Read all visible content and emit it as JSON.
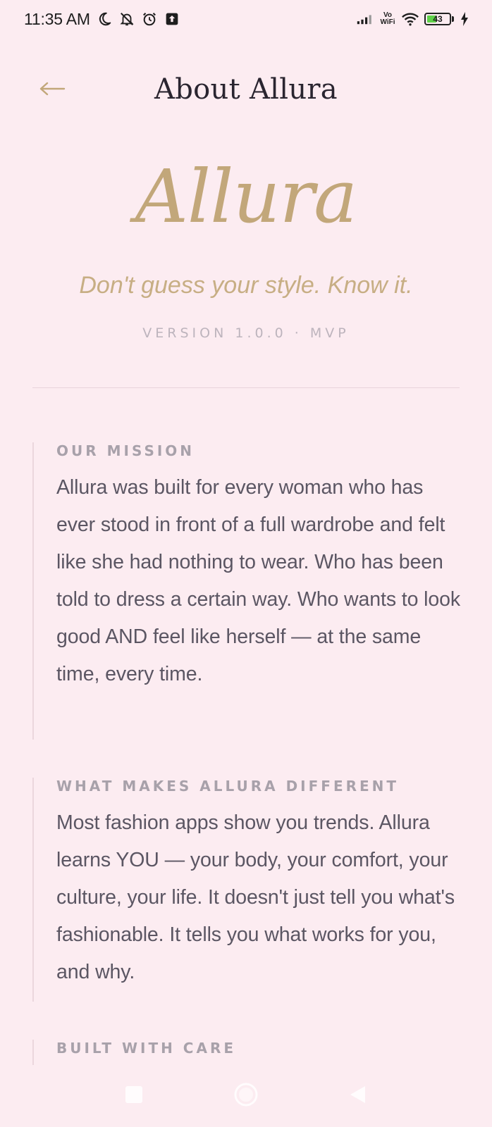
{
  "status_bar": {
    "time": "11:35 AM",
    "icons": [
      "moon-icon",
      "bell-off-icon",
      "alarm-icon",
      "upload-icon",
      "signal-icon",
      "vowifi-icon",
      "wifi-icon",
      "battery-icon",
      "charging-icon"
    ],
    "vowifi_line1": "Vo",
    "vowifi_line2": "WiFi",
    "battery_level": "43",
    "battery_fraction": 0.43
  },
  "header": {
    "back_icon": "arrow-left-icon",
    "title": "About Allura"
  },
  "hero": {
    "brand": "Allura",
    "tagline": "Don't guess your style. Know it.",
    "version": "VERSION 1.0.0 · MVP"
  },
  "sections": [
    {
      "heading": "OUR MISSION",
      "body": "Allura was built for every woman who has ever stood in front of a full wardrobe and felt like she had nothing to wear. Who has been told to dress a certain way. Who wants to look good AND feel like herself — at the same time, every time."
    },
    {
      "heading": "WHAT MAKES ALLURA DIFFERENT",
      "body": "Most fashion apps show you trends. Allura learns YOU — your body, your comfort, your culture, your life. It doesn't just tell you what's fashionable. It tells you what works for you, and why."
    },
    {
      "heading": "BUILT WITH CARE"
    }
  ],
  "nav_bar": {
    "icons": [
      "recents-square-icon",
      "home-circle-icon",
      "back-triangle-icon"
    ]
  },
  "colors": {
    "background": "#fcecf1",
    "accent_gold": "#c2a77a",
    "body_text": "#5b5663",
    "title_text": "#2a2530",
    "muted": "#a8a1aa"
  }
}
